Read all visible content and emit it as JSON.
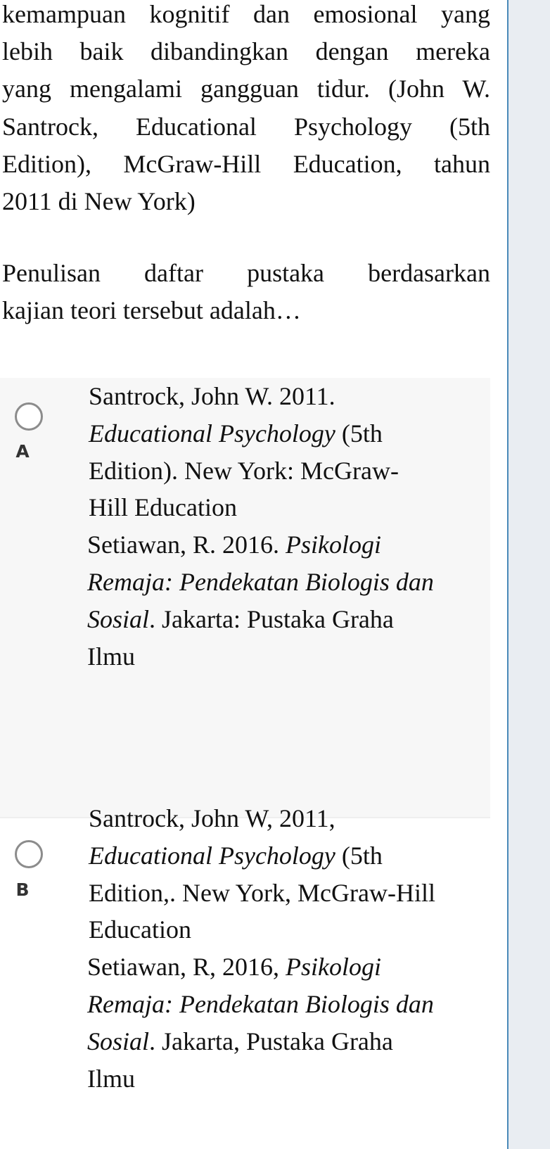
{
  "question": {
    "context_lines": [
      "kemampuan kognitif dan emosional yang",
      "lebih baik dibandingkan dengan mereka",
      "yang mengalami gangguan tidur. (John W.",
      "Santrock, Educational Psychology (5th",
      "Edition), McGraw-Hill Education, tahun",
      "2011 di New York)"
    ],
    "prompt_lines": [
      "Penulisan daftar pustaka berdasarkan",
      "kajian teori tersebut adalah…"
    ]
  },
  "options": [
    {
      "letter": "A",
      "selected": false,
      "lines": [
        [
          {
            "t": "Santrock, John W. 2011.",
            "i": false
          }
        ],
        [
          {
            "t": "Educational Psychology",
            "i": true
          },
          {
            "t": " (5th",
            "i": false
          }
        ],
        [
          {
            "t": "Edition). New York: McGraw-",
            "i": false
          }
        ],
        [
          {
            "t": "Hill Education",
            "i": false
          }
        ],
        [
          {
            "t": "Setiawan, R. 2016. ",
            "i": false
          },
          {
            "t": "Psikologi",
            "i": true
          }
        ],
        [
          {
            "t": "Remaja: Pendekatan Biologis dan",
            "i": true
          }
        ],
        [
          {
            "t": "Sosial",
            "i": true
          },
          {
            "t": ". Jakarta: Pustaka Graha",
            "i": false
          }
        ],
        [
          {
            "t": "Ilmu",
            "i": false
          }
        ]
      ]
    },
    {
      "letter": "B",
      "selected": false,
      "lines": [
        [
          {
            "t": "Santrock, John W, 2011,",
            "i": false
          }
        ],
        [
          {
            "t": "Educational Psychology",
            "i": true
          },
          {
            "t": " (5th",
            "i": false
          }
        ],
        [
          {
            "t": "Edition,. New York, McGraw-Hill",
            "i": false
          }
        ],
        [
          {
            "t": "Education",
            "i": false
          }
        ],
        [
          {
            "t": "Setiawan, R, 2016, ",
            "i": false
          },
          {
            "t": "Psikologi",
            "i": true
          }
        ],
        [
          {
            "t": "Remaja: Pendekatan Biologis dan",
            "i": true
          }
        ],
        [
          {
            "t": "Sosial",
            "i": true
          },
          {
            "t": ". Jakarta, Pustaka Graha",
            "i": false
          }
        ],
        [
          {
            "t": "Ilmu",
            "i": false
          }
        ]
      ]
    }
  ],
  "theme": {
    "panel_border": "#4a8ab8",
    "panel_bg": "#e9edf2",
    "option_hover_bg": "#f7f7f7",
    "radio_border": "#8c8c8c"
  }
}
